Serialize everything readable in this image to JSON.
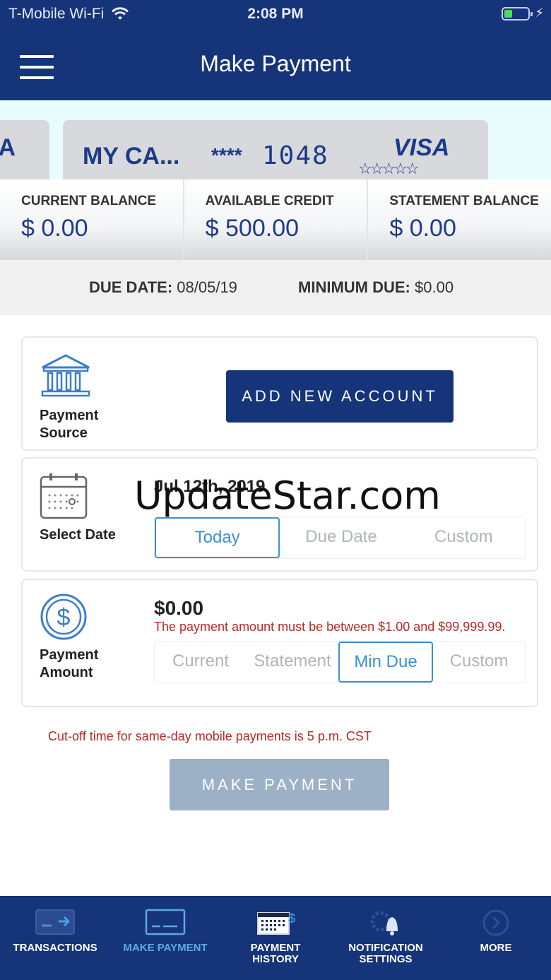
{
  "status_bar": {
    "carrier": "T-Mobile Wi-Fi",
    "time": "2:08 PM",
    "battery_level": 0.35
  },
  "header": {
    "title": "Make Payment"
  },
  "cards": {
    "prev_fragment": "A",
    "current": {
      "name": "MY CA...",
      "mask": "****",
      "last4": "1048",
      "network": "VISA"
    }
  },
  "balances": [
    {
      "label": "CURRENT BALANCE",
      "value": "$ 0.00"
    },
    {
      "label": "AVAILABLE CREDIT",
      "value": "$ 500.00"
    },
    {
      "label": "STATEMENT BALANCE",
      "value": "$ 0.00"
    }
  ],
  "due": {
    "due_date_label": "DUE DATE:",
    "due_date_value": "08/05/19",
    "min_due_label": "MINIMUM DUE:",
    "min_due_value": "$0.00"
  },
  "payment_source": {
    "label_line1": "Payment",
    "label_line2": "Source",
    "button": "ADD NEW ACCOUNT"
  },
  "select_date": {
    "label": "Select Date",
    "date": "Jul 12th, 2019",
    "options": [
      "Today",
      "Due Date",
      "Custom"
    ],
    "selected": "Today"
  },
  "watermark": "UpdateStar.com",
  "payment_amount": {
    "label_line1": "Payment",
    "label_line2": "Amount",
    "amount": "$0.00",
    "error": "The payment amount must be between $1.00 and $99,999.99.",
    "options": [
      "Current",
      "Statement",
      "Min Due",
      "Custom"
    ],
    "selected": "Min Due"
  },
  "cutoff_note": "Cut-off time for same-day mobile payments is 5 p.m. CST",
  "make_payment_button": "MAKE PAYMENT",
  "tabs": [
    {
      "line1": "TRANSACTIONS",
      "line2": "",
      "icon": "transactions-icon",
      "active": false
    },
    {
      "line1": "MAKE PAYMENT",
      "line2": "",
      "icon": "card-icon",
      "active": true
    },
    {
      "line1": "PAYMENT",
      "line2": "HISTORY",
      "icon": "calendar-dollar-icon",
      "active": false
    },
    {
      "line1": "NOTIFICATION",
      "line2": "SETTINGS",
      "icon": "bell-gear-icon",
      "active": false
    },
    {
      "line1": "MORE",
      "line2": "",
      "icon": "more-icon",
      "active": false
    }
  ],
  "colors": {
    "brand_navy": "#16347a",
    "accent_blue": "#3a8fd8",
    "error_red": "#b52a24",
    "disabled_button": "#9cb0c6"
  }
}
